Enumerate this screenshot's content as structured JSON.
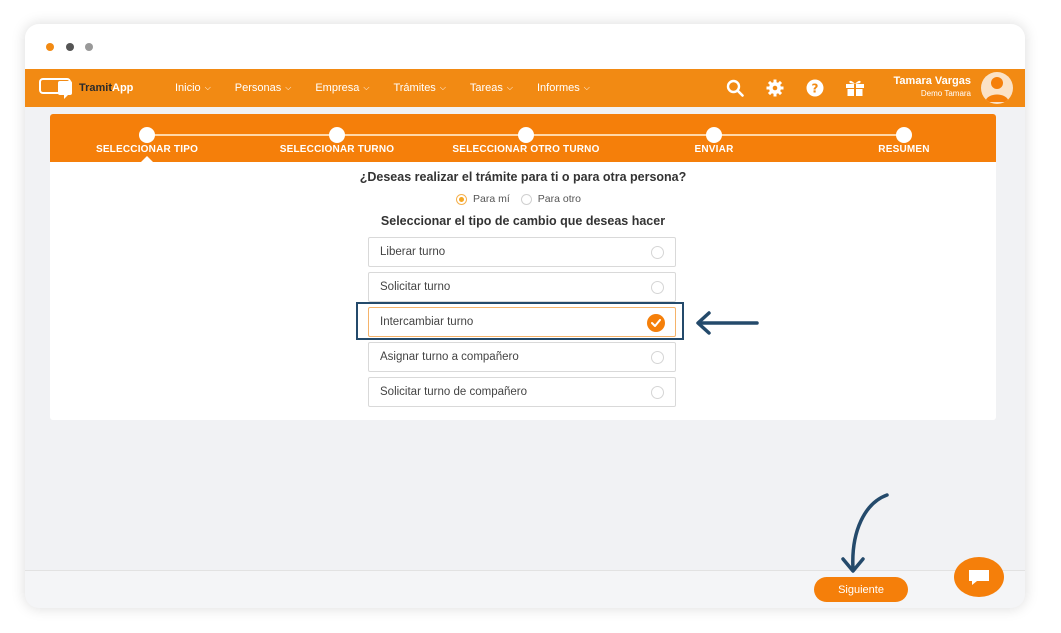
{
  "brand": {
    "name_part1": "Tramit",
    "name_part2": "App",
    "orange": "#f28a13",
    "navy": "#244a6b"
  },
  "nav": {
    "menu": [
      {
        "label": "Inicio"
      },
      {
        "label": "Personas"
      },
      {
        "label": "Empresa"
      },
      {
        "label": "Trámites"
      },
      {
        "label": "Tareas"
      },
      {
        "label": "Informes"
      }
    ],
    "icons": [
      "search-icon",
      "gear-icon",
      "help-icon",
      "gift-icon"
    ],
    "user": {
      "name": "Tamara Vargas",
      "company": "Demo Tamara"
    }
  },
  "stepper": {
    "steps": [
      {
        "label": "SELECCIONAR TIPO"
      },
      {
        "label": "SELECCIONAR TURNO"
      },
      {
        "label": "SELECCIONAR OTRO TURNO"
      },
      {
        "label": "ENVIAR"
      },
      {
        "label": "RESUMEN"
      }
    ],
    "active_index": 0
  },
  "form": {
    "question": "¿Deseas realizar el trámite para ti o para otra persona?",
    "for_options": [
      {
        "label": "Para mí",
        "checked": true
      },
      {
        "label": "Para otro",
        "checked": false
      }
    ],
    "change_title": "Seleccionar el tipo de cambio que deseas hacer",
    "change_options": [
      {
        "label": "Liberar turno",
        "selected": false
      },
      {
        "label": "Solicitar turno",
        "selected": false
      },
      {
        "label": "Intercambiar turno",
        "selected": true
      },
      {
        "label": "Asignar turno a compañero",
        "selected": false
      },
      {
        "label": "Solicitar turno de compañero",
        "selected": false
      }
    ]
  },
  "footer": {
    "next_label": "Siguiente"
  }
}
